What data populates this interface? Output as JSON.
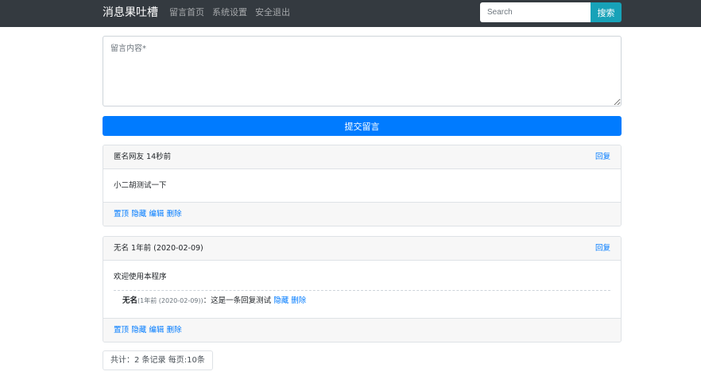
{
  "navbar": {
    "brand": "消息果吐槽",
    "links": [
      "留言首页",
      "系统设置",
      "安全退出"
    ],
    "search_placeholder": "Search",
    "search_button": "搜索"
  },
  "form": {
    "content_placeholder": "留言内容*",
    "submit_label": "提交留言"
  },
  "messages": [
    {
      "author": "匿名网友",
      "time": "14秒前",
      "reply_label": "回复",
      "content": "小二胡测试一下",
      "actions": [
        "置顶",
        "隐藏",
        "编辑",
        "删除"
      ]
    },
    {
      "author": "无名",
      "time": "1年前 (2020-02-09)",
      "reply_label": "回复",
      "content": "欢迎使用本程序",
      "reply": {
        "author": "无名",
        "time": "(1年前 (2020-02-09))",
        "separator": "：",
        "content": "这是一条回复测试",
        "actions": [
          "隐藏",
          "删除"
        ]
      },
      "actions": [
        "置顶",
        "隐藏",
        "编辑",
        "删除"
      ]
    }
  ],
  "pagination": {
    "summary": "共计：2 条记录 每页:10条"
  },
  "colors": {
    "navbar_bg": "#343a40",
    "primary": "#007bff",
    "info": "#17a2b8"
  }
}
